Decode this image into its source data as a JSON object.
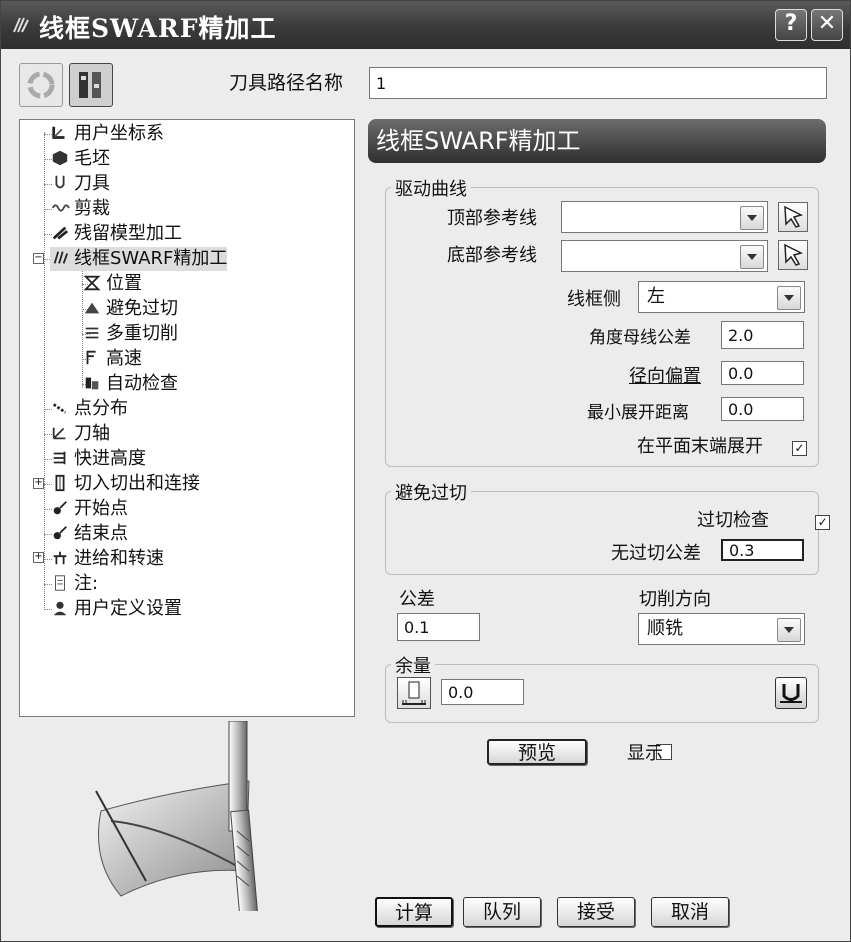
{
  "window": {
    "title": "线框SWARF精加工",
    "help_label": "?",
    "close_label": "✕"
  },
  "toolpath": {
    "name_label": "刀具路径名称",
    "name_value": "1"
  },
  "tree": {
    "items": [
      {
        "label": "用户坐标系",
        "icon": "ucs-icon"
      },
      {
        "label": "毛坯",
        "icon": "block-icon"
      },
      {
        "label": "刀具",
        "icon": "tool-icon"
      },
      {
        "label": "剪裁",
        "icon": "limit-icon"
      },
      {
        "label": "残留模型加工",
        "icon": "rest-model-icon"
      },
      {
        "label": "线框SWARF精加工",
        "icon": "swarf-icon"
      },
      {
        "label": "位置",
        "icon": "position-icon"
      },
      {
        "label": "避免过切",
        "icon": "gouge-icon"
      },
      {
        "label": "多重切削",
        "icon": "multiple-cuts-icon"
      },
      {
        "label": "高速",
        "icon": "high-speed-icon"
      },
      {
        "label": "自动检查",
        "icon": "auto-verify-icon"
      },
      {
        "label": "点分布",
        "icon": "point-distribution-icon"
      },
      {
        "label": "刀轴",
        "icon": "tool-axis-icon"
      },
      {
        "label": "快进高度",
        "icon": "rapid-move-icon"
      },
      {
        "label": "切入切出和连接",
        "icon": "leads-links-icon"
      },
      {
        "label": "开始点",
        "icon": "start-point-icon"
      },
      {
        "label": "结束点",
        "icon": "end-point-icon"
      },
      {
        "label": "进给和转速",
        "icon": "feeds-speeds-icon"
      },
      {
        "label": "注:",
        "icon": "notes-icon"
      },
      {
        "label": "用户定义设置",
        "icon": "user-settings-icon"
      }
    ]
  },
  "panel": {
    "header": "线框SWARF精加工",
    "drive": {
      "group_title": "驱动曲线",
      "top_label": "顶部参考线",
      "top_value": "",
      "bottom_label": "底部参考线",
      "bottom_value": "",
      "side_label": "线框侧",
      "side_value": "左",
      "angle_tol_label": "角度母线公差",
      "angle_tol_value": "2.0",
      "radial_offset_label": "径向偏置",
      "radial_offset_value": "0.0",
      "min_unroll_label": "最小展开距离",
      "min_unroll_value": "0.0",
      "unroll_label": "在平面末端展开",
      "unroll_mark": "✓"
    },
    "gouge": {
      "group_title": "避免过切",
      "check_label": "过切检查",
      "check_mark": "✓",
      "gouge_tol_label": "无过切公差",
      "gouge_tol_value": "0.3"
    },
    "tolerance_label": "公差",
    "tolerance_value": "0.1",
    "cut_dir_label": "切削方向",
    "cut_dir_value": "顺铣",
    "thickness_label": "余量",
    "thickness_value": "0.0",
    "preview_label": "预览",
    "show_label": "显示"
  },
  "buttons": {
    "calculate": "计算",
    "queue": "队列",
    "accept": "接受",
    "cancel": "取消"
  }
}
